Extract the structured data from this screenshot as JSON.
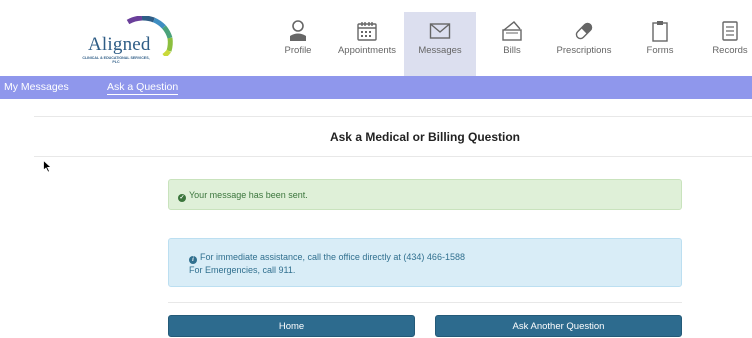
{
  "logo": {
    "word": "Aligned",
    "sub": "CLINICAL & EDUCATIONAL SERVICES, PLC"
  },
  "nav": [
    {
      "label": "Profile",
      "icon": "profile-icon",
      "active": false
    },
    {
      "label": "Appointments",
      "icon": "calendar-icon",
      "active": false
    },
    {
      "label": "Messages",
      "icon": "envelope-icon",
      "active": true
    },
    {
      "label": "Bills",
      "icon": "wallet-icon",
      "active": false
    },
    {
      "label": "Prescriptions",
      "icon": "pill-icon",
      "active": false
    },
    {
      "label": "Forms",
      "icon": "clipboard-icon",
      "active": false
    },
    {
      "label": "Records",
      "icon": "records-icon",
      "active": false
    }
  ],
  "subnav": {
    "my_messages": "My Messages",
    "ask_question": "Ask a Question"
  },
  "page_title": "Ask a Medical or Billing Question",
  "alerts": {
    "success": "Your message has been sent.",
    "info_line1": "For immediate assistance, call the office directly at (434) 466-1588",
    "info_line2": "For Emergencies, call 911."
  },
  "buttons": {
    "home": "Home",
    "ask_another": "Ask Another Question"
  },
  "colors": {
    "subnav": "#8f97ec",
    "active_tab": "#dcdfef",
    "button": "#2d6b8e",
    "success_bg": "#dff0d8",
    "info_bg": "#d9edf7"
  }
}
